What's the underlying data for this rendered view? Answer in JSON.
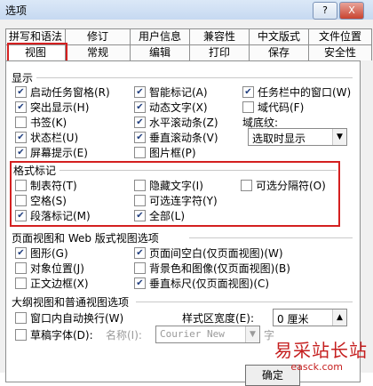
{
  "window": {
    "title": "选项",
    "help_button": "?",
    "close_button": "X"
  },
  "tabs_row1": [
    "拼写和语法",
    "修订",
    "用户信息",
    "兼容性",
    "中文版式",
    "文件位置"
  ],
  "tabs_row2": [
    "视图",
    "常规",
    "编辑",
    "打印",
    "保存",
    "安全性"
  ],
  "display": {
    "title": "显示",
    "items": [
      {
        "label": "启动任务窗格(R)",
        "checked": true
      },
      {
        "label": "智能标记(A)",
        "checked": true
      },
      {
        "label": "任务栏中的窗口(W)",
        "checked": true
      },
      {
        "label": "突出显示(H)",
        "checked": true
      },
      {
        "label": "动态文字(X)",
        "checked": true
      },
      {
        "label": "域代码(F)",
        "checked": false
      },
      {
        "label": "书签(K)",
        "checked": false
      },
      {
        "label": "水平滚动条(Z)",
        "checked": true
      },
      {
        "label": "状态栏(U)",
        "checked": true
      },
      {
        "label": "垂直滚动条(V)",
        "checked": true
      },
      {
        "label": "屏幕提示(E)",
        "checked": true
      },
      {
        "label": "图片框(P)",
        "checked": false
      }
    ],
    "field_shading_label": "域底纹:",
    "field_shading_value": "选取时显示"
  },
  "formatting_marks": {
    "title": "格式标记",
    "items": [
      {
        "label": "制表符(T)",
        "checked": false
      },
      {
        "label": "隐藏文字(I)",
        "checked": false
      },
      {
        "label": "可选分隔符(O)",
        "checked": false
      },
      {
        "label": "空格(S)",
        "checked": false
      },
      {
        "label": "可选连字符(Y)",
        "checked": false
      },
      {
        "label": "段落标记(M)",
        "checked": true
      },
      {
        "label": "全部(L)",
        "checked": true
      }
    ]
  },
  "print_web": {
    "title": "页面视图和 Web 版式视图选项",
    "items": [
      {
        "label": "图形(G)",
        "checked": true
      },
      {
        "label": "页面间空白(仅页面视图)(W)",
        "checked": true
      },
      {
        "label": "对象位置(J)",
        "checked": false
      },
      {
        "label": "背景色和图像(仅页面视图)(B)",
        "checked": false
      },
      {
        "label": "正文边框(X)",
        "checked": false
      },
      {
        "label": "垂直标尺(仅页面视图)(C)",
        "checked": true
      }
    ]
  },
  "outline": {
    "title": "大纲视图和普通视图选项",
    "wrap": "窗口内自动换行(W)",
    "draft": "草稿字体(D):",
    "name_label": "名称(I):",
    "font_value": "Courier New",
    "size_label": "字",
    "style_width_label": "样式区宽度(E):",
    "style_width_value": "0 厘米"
  },
  "ok_button": "确定",
  "watermark": {
    "main": "易采站长站",
    "sub": "easck.com"
  }
}
